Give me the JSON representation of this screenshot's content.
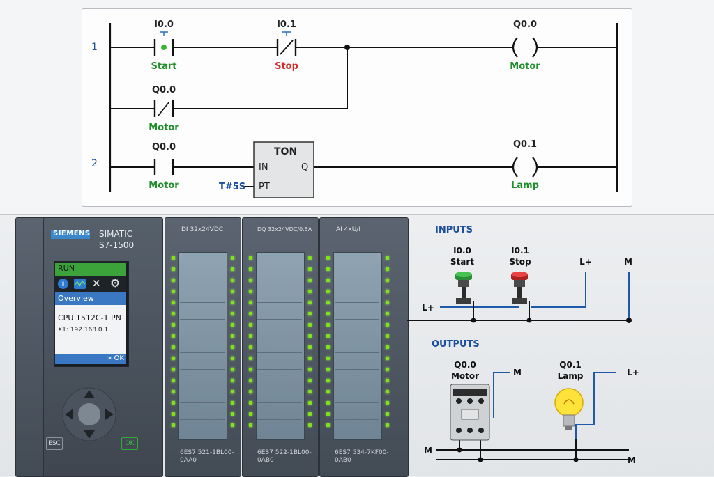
{
  "ladder": {
    "rung1_number": "1",
    "rung2_number": "2",
    "contacts": [
      {
        "address": "I0.0",
        "name": "Start"
      },
      {
        "address": "I0.1",
        "name": "Stop"
      },
      {
        "address": "Q0.0",
        "name": "Motor"
      },
      {
        "address": "Q0.0",
        "name": "Motor"
      }
    ],
    "coils": [
      {
        "address": "Q0.0",
        "name": "Motor"
      },
      {
        "address": "Q0.1",
        "name": "Lamp"
      }
    ],
    "timer": {
      "type": "TON",
      "in_label": "IN",
      "q_label": "Q",
      "pt_label": "PT",
      "preset": "T#5S"
    }
  },
  "plc": {
    "brand": "SIEMENS",
    "series": "SIMATIC",
    "model": "S7-1500",
    "display": {
      "status": "RUN",
      "menu": "Overview",
      "cpu": "CPU 1512C-1 PN",
      "ip": "X1: 192.168.0.1",
      "ok_hint": "> OK"
    },
    "keys": {
      "esc": "ESC",
      "ok": "OK"
    },
    "modules": [
      {
        "header": "DI 32x24VDC",
        "order_line1": "6ES7 521-1BL00-",
        "order_line2": "0AA0"
      },
      {
        "header": "DQ 32x24VDC/0.5A",
        "order_line1": "6ES7 522-1BL00-",
        "order_line2": "0AB0"
      },
      {
        "header": "AI 4xU/I",
        "order_line1": "6ES7 534-7KF00-",
        "order_line2": "0AB0"
      }
    ]
  },
  "wiring": {
    "inputs_title": "INPUTS",
    "outputs_title": "OUTPUTS",
    "input_start": {
      "address": "I0.0",
      "name": "Start"
    },
    "input_stop": {
      "address": "I0.1",
      "name": "Stop"
    },
    "lplus": "L+",
    "m": "M",
    "output_motor": {
      "address": "Q0.0",
      "name": "Motor"
    },
    "output_lamp": {
      "address": "Q0.1",
      "name": "Lamp"
    }
  },
  "colors": {
    "accent_blue": "#1b4f9a",
    "start_green": "#1f8f2a",
    "stop_red": "#d22d2d",
    "run_green": "#3ca33a",
    "led_green": "#7ee21d"
  }
}
